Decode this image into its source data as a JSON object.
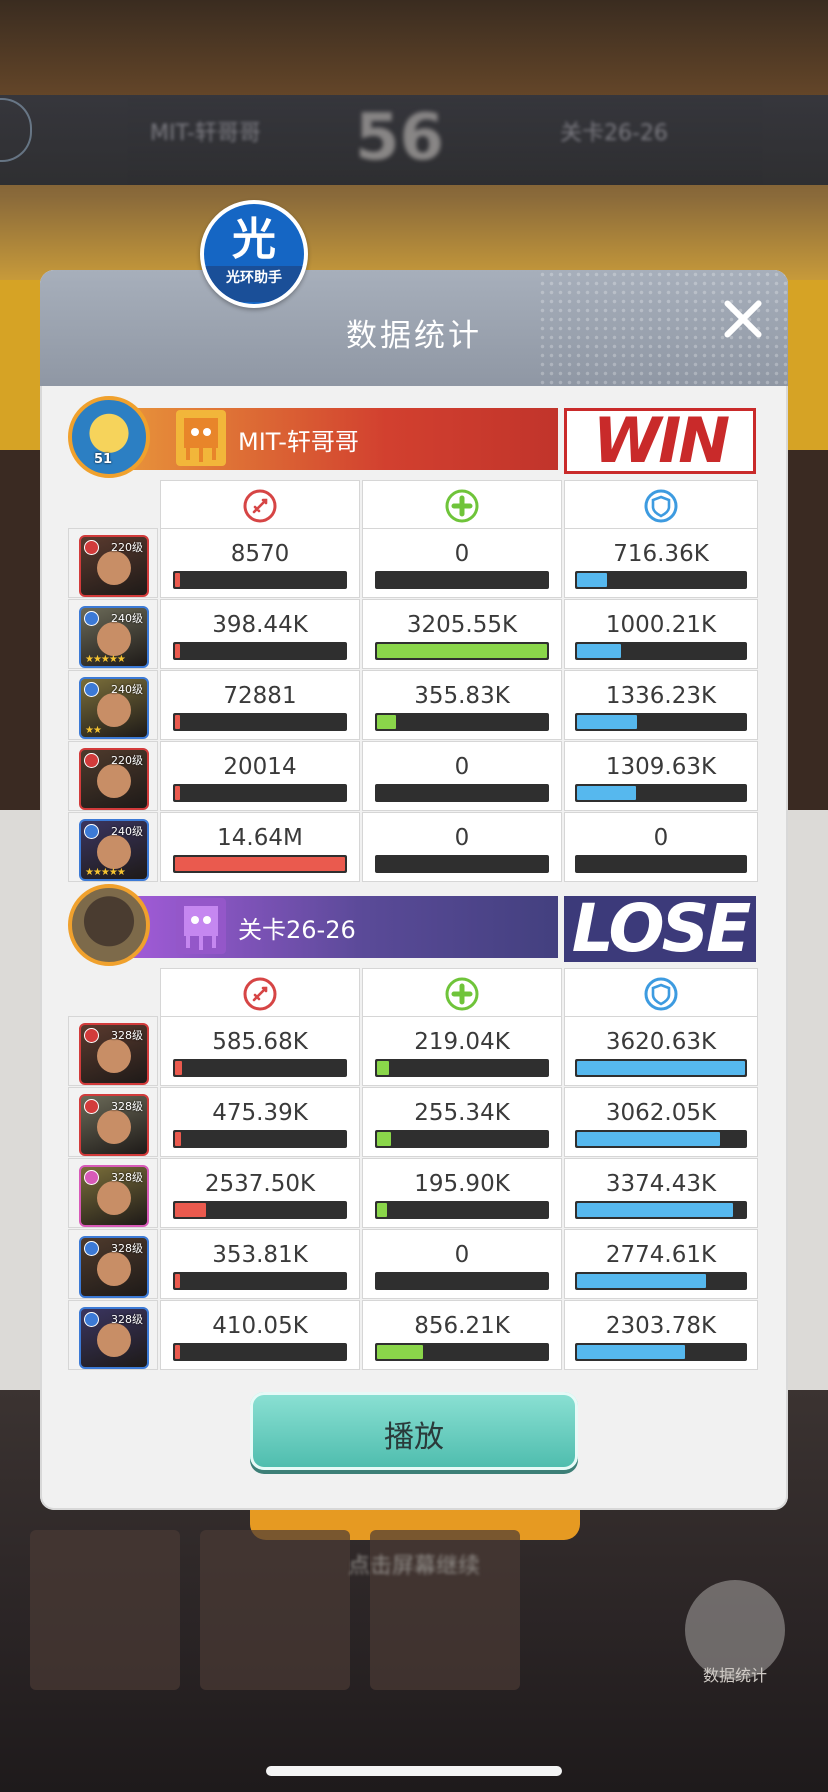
{
  "background": {
    "banner_left": "MIT-轩哥哥",
    "banner_right": "关卡26-26",
    "banner_round": "56",
    "continue_hint": "点击屏幕继续",
    "stats_button_label": "数据统计"
  },
  "assistant_badge": {
    "char": "光",
    "label": "光环助手"
  },
  "modal": {
    "title": "数据统计"
  },
  "icons": {
    "damage": "sword-circle-icon",
    "heal": "plus-circle-icon",
    "tank": "shield-circle-icon",
    "close": "close-icon"
  },
  "colors": {
    "damage_bar": "#ea5a4e",
    "heal_bar": "#8ad64a",
    "tank_bar": "#56b8ee",
    "win_red": "#c92a2a",
    "lose_purple": "#3c3a7a"
  },
  "teams": [
    {
      "name": "MIT-轩哥哥",
      "player_level": "51",
      "result": "WIN",
      "heroes": [
        {
          "level": "220级",
          "faction": "red",
          "stars": "",
          "damage": "8570",
          "damage_ratio": 0.001,
          "heal": "0",
          "heal_ratio": 0,
          "tank": "716.36K",
          "tank_ratio": 0.18
        },
        {
          "level": "240级",
          "faction": "blue",
          "stars": "★★★★★",
          "damage": "398.44K",
          "damage_ratio": 0.03,
          "heal": "3205.55K",
          "heal_ratio": 1.0,
          "tank": "1000.21K",
          "tank_ratio": 0.26
        },
        {
          "level": "240级",
          "faction": "blue",
          "stars": "★★",
          "damage": "72881",
          "damage_ratio": 0.005,
          "heal": "355.83K",
          "heal_ratio": 0.11,
          "tank": "1336.23K",
          "tank_ratio": 0.36
        },
        {
          "level": "220级",
          "faction": "red",
          "stars": "",
          "damage": "20014",
          "damage_ratio": 0.001,
          "heal": "0",
          "heal_ratio": 0,
          "tank": "1309.63K",
          "tank_ratio": 0.35
        },
        {
          "level": "240级",
          "faction": "blue",
          "stars": "★★★★★",
          "damage": "14.64M",
          "damage_ratio": 1.0,
          "heal": "0",
          "heal_ratio": 0,
          "tank": "0",
          "tank_ratio": 0
        }
      ]
    },
    {
      "name": "关卡26-26",
      "result": "LOSE",
      "heroes": [
        {
          "level": "328级",
          "faction": "red",
          "damage": "585.68K",
          "damage_ratio": 0.04,
          "heal": "219.04K",
          "heal_ratio": 0.07,
          "tank": "3620.63K",
          "tank_ratio": 1.0
        },
        {
          "level": "328级",
          "faction": "red",
          "damage": "475.39K",
          "damage_ratio": 0.035,
          "heal": "255.34K",
          "heal_ratio": 0.08,
          "tank": "3062.05K",
          "tank_ratio": 0.85
        },
        {
          "level": "328级",
          "faction": "pink",
          "damage": "2537.50K",
          "damage_ratio": 0.18,
          "heal": "195.90K",
          "heal_ratio": 0.06,
          "tank": "3374.43K",
          "tank_ratio": 0.93
        },
        {
          "level": "328级",
          "faction": "blue",
          "damage": "353.81K",
          "damage_ratio": 0.025,
          "heal": "0",
          "heal_ratio": 0,
          "tank": "2774.61K",
          "tank_ratio": 0.77
        },
        {
          "level": "328级",
          "faction": "blue",
          "damage": "410.05K",
          "damage_ratio": 0.03,
          "heal": "856.21K",
          "heal_ratio": 0.27,
          "tank": "2303.78K",
          "tank_ratio": 0.64
        }
      ]
    }
  ],
  "play_button": {
    "label": "播放"
  }
}
